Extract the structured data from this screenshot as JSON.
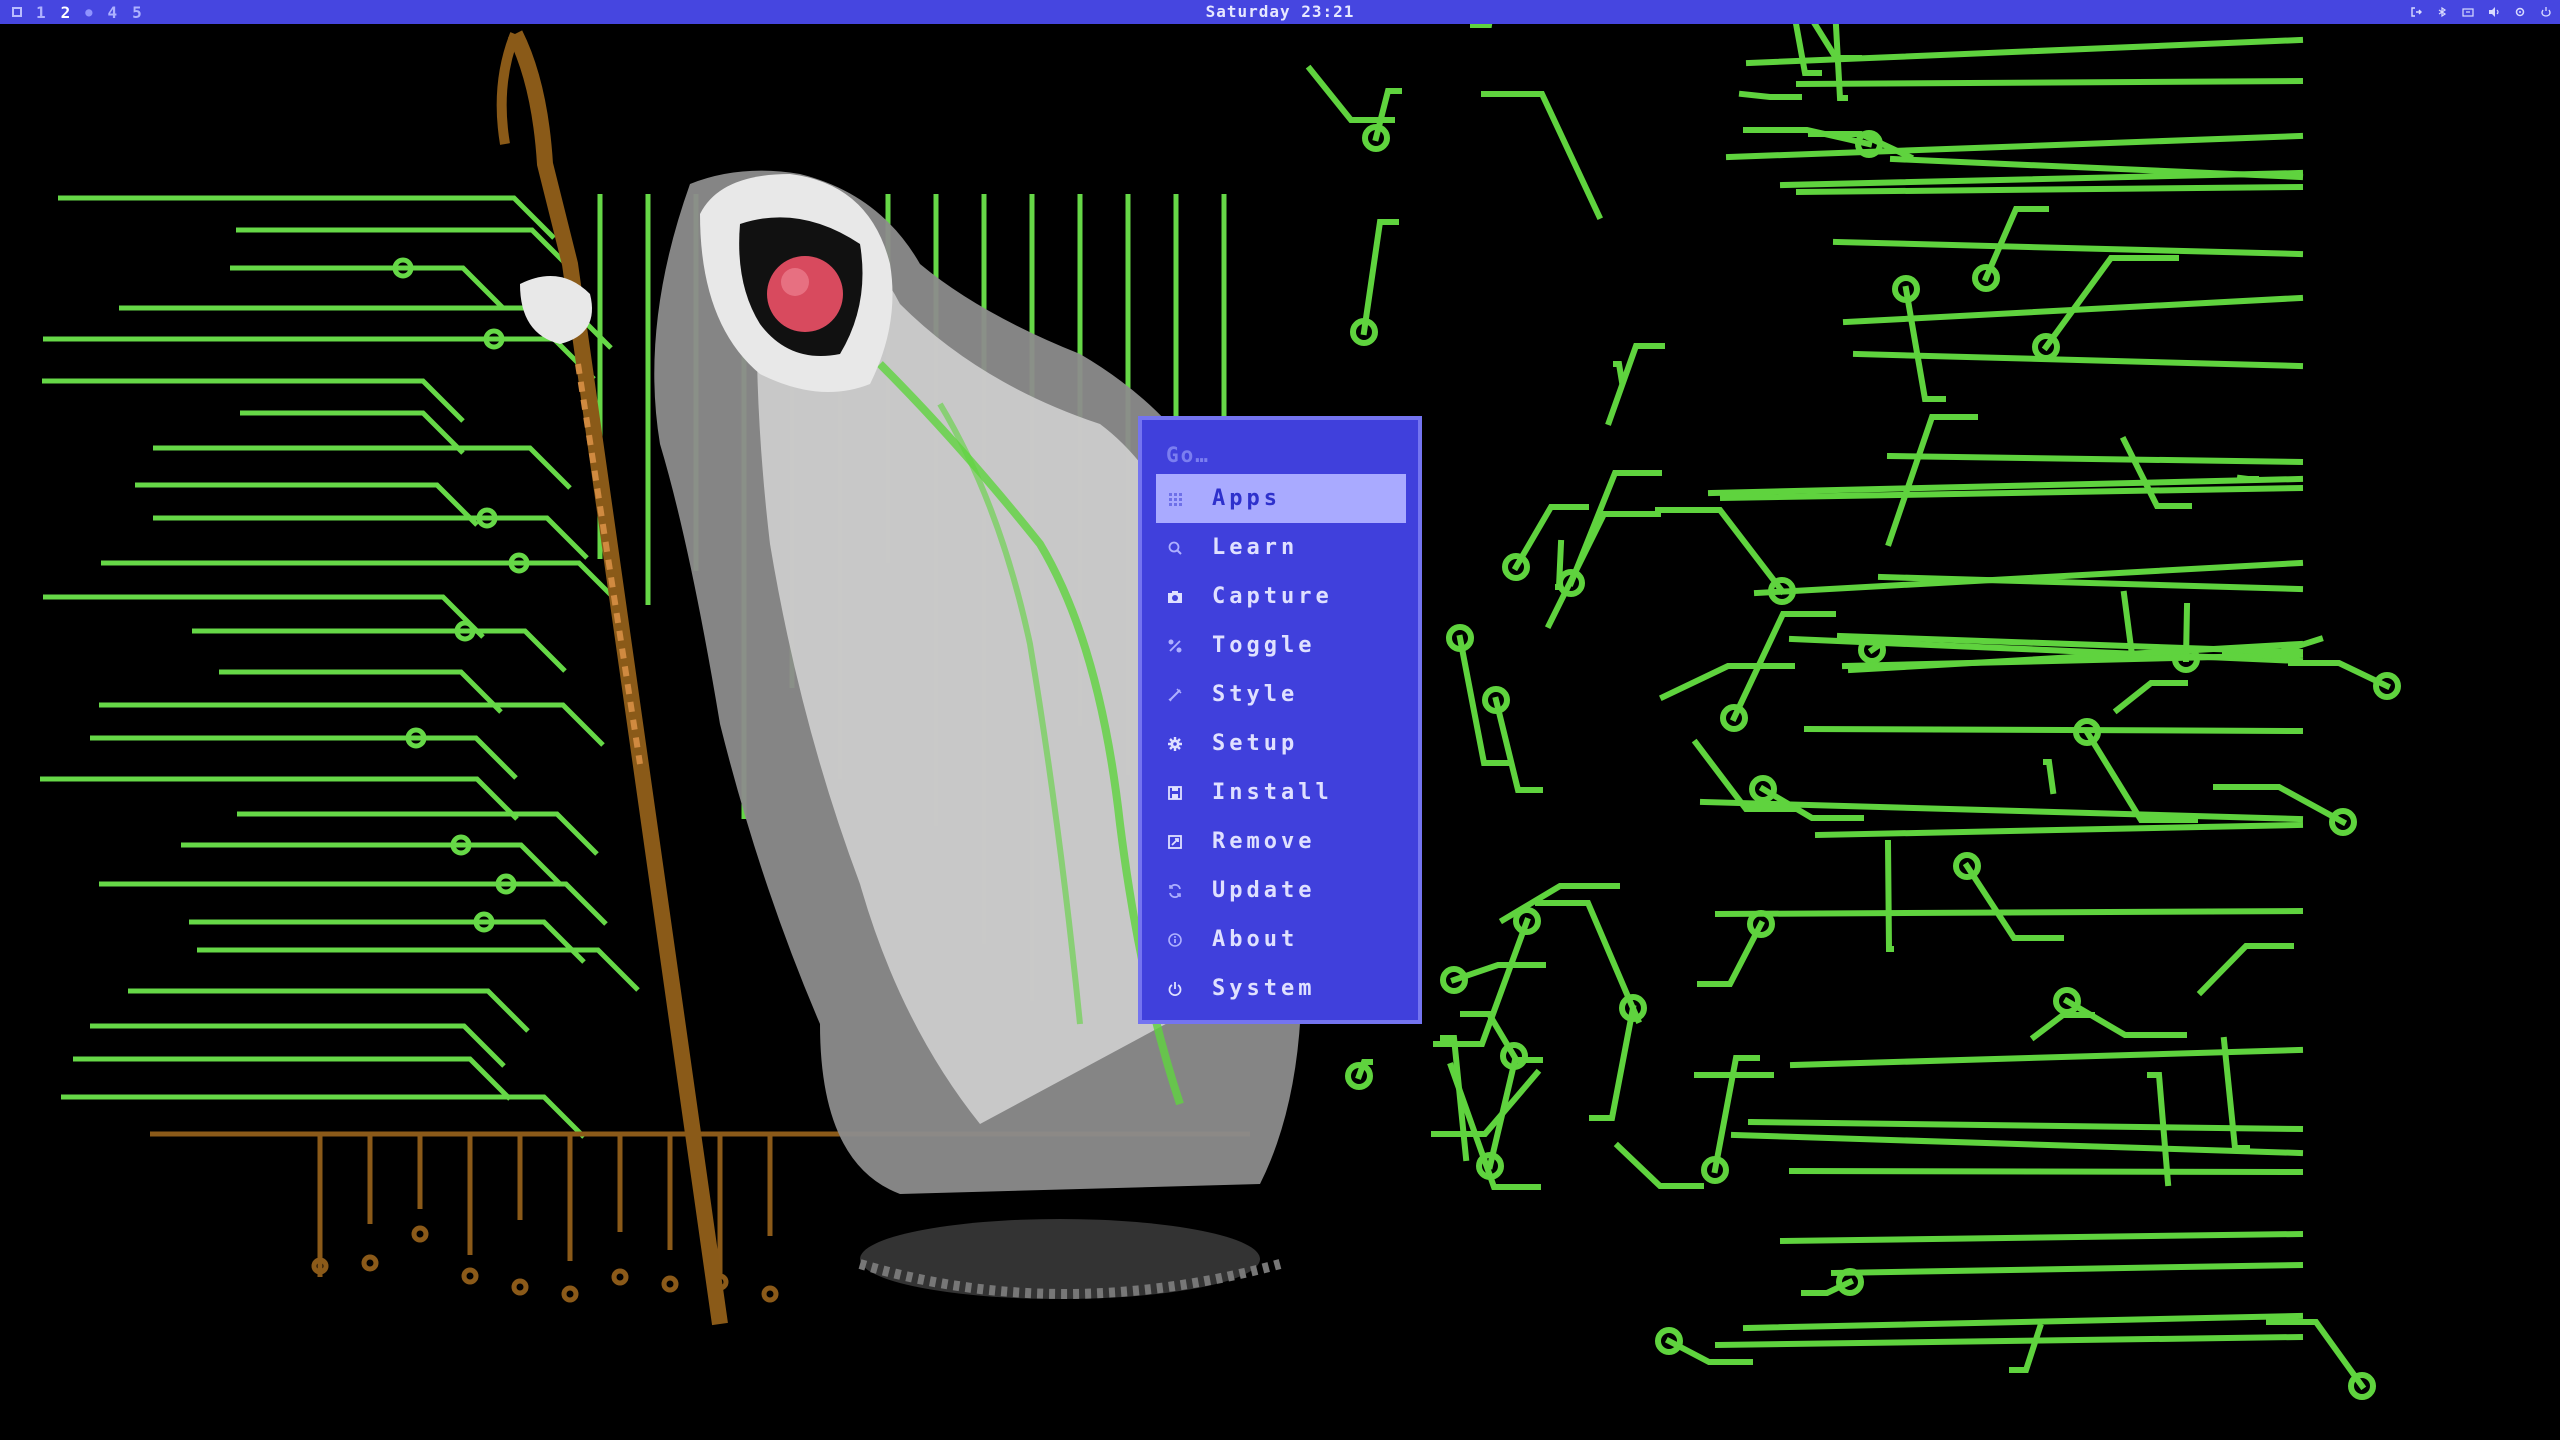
{
  "topbar": {
    "workspaces": [
      "1",
      "2",
      "4",
      "5"
    ],
    "active_workspace": "2",
    "clock": "Saturday 23:21",
    "tray_icons": [
      "logout-icon",
      "bluetooth-icon",
      "network-icon",
      "volume-icon",
      "settings-icon",
      "battery-icon"
    ]
  },
  "menu": {
    "search_placeholder": "Go…",
    "items": [
      {
        "label": "Apps",
        "icon": "grid-icon",
        "selected": true
      },
      {
        "label": "Learn",
        "icon": "magnifier-icon"
      },
      {
        "label": "Capture",
        "icon": "camera-icon"
      },
      {
        "label": "Toggle",
        "icon": "toggle-icon"
      },
      {
        "label": "Style",
        "icon": "brush-icon"
      },
      {
        "label": "Setup",
        "icon": "gear-icon"
      },
      {
        "label": "Install",
        "icon": "install-icon"
      },
      {
        "label": "Remove",
        "icon": "remove-icon"
      },
      {
        "label": "Update",
        "icon": "refresh-icon"
      },
      {
        "label": "About",
        "icon": "info-icon"
      },
      {
        "label": "System",
        "icon": "power-icon"
      }
    ]
  },
  "colors": {
    "accent": "#4646e0",
    "menu_bg": "#4040dc",
    "menu_selected": "#a9aaff",
    "circuit_green": "#6ad44a",
    "circuit_brown": "#8a5a18"
  }
}
